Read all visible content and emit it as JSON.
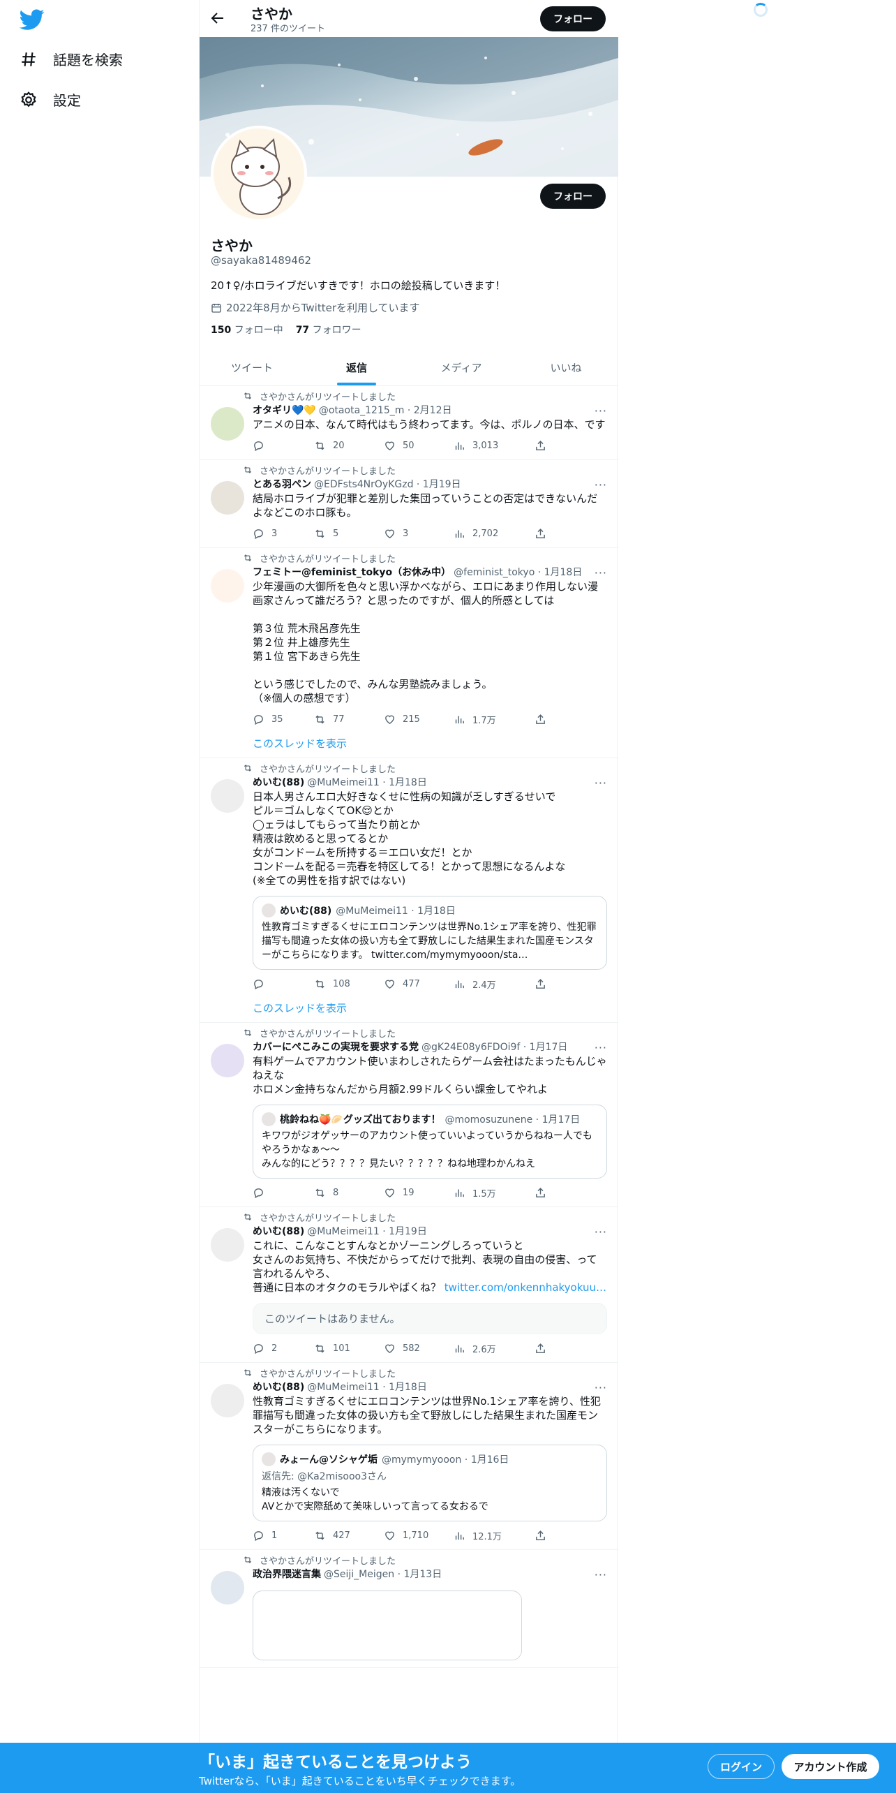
{
  "sidebar": {
    "items": [
      {
        "label": "話題を検索",
        "icon": "hashtag-icon"
      },
      {
        "label": "設定",
        "icon": "gear-icon"
      }
    ]
  },
  "header": {
    "name": "さやか",
    "tweet_count": "237 件のツイート",
    "follow_label": "フォロー"
  },
  "profile": {
    "name": "さやか",
    "handle": "@sayaka81489462",
    "bio": "20↑♀/ホロライブだいすきです！ホロの絵投稿していきます！",
    "joined": "2022年8月からTwitterを利用しています",
    "following_count": "150",
    "following_label": "フォロー中",
    "followers_count": "77",
    "followers_label": "フォロワー",
    "follow_label": "フォロー"
  },
  "tabs": [
    {
      "label": "ツイート",
      "active": false
    },
    {
      "label": "返信",
      "active": true
    },
    {
      "label": "メディア",
      "active": false
    },
    {
      "label": "いいね",
      "active": false
    }
  ],
  "retweet_label": "さやかさんがリツイートしました",
  "show_thread_label": "このスレッドを表示",
  "tweets": [
    {
      "name": "オタギリ💙💛",
      "meta": "@otaota_1215_m · 2月12日",
      "text": "アニメの日本、なんて時代はもう終わってます。今は、ポルノの日本、です",
      "reply": "",
      "retweets": "20",
      "likes": "50",
      "views": "3,013"
    },
    {
      "name": "とある羽ペン",
      "meta": "@EDFsts4NrOyKGzd · 1月19日",
      "text": "結局ホロライブが犯罪と差別した集団っていうことの否定はできないんだよなどこのホロ豚も。",
      "reply": "3",
      "retweets": "5",
      "likes": "3",
      "views": "2,702"
    },
    {
      "name": "フェミトー@feminist_tokyo（お休み中）",
      "meta": "@feminist_tokyo · 1月18日",
      "text": "少年漫画の大御所を色々と思い浮かべながら、エロにあまり作用しない漫画家さんって誰だろう？と思ったのですが、個人的所感としては\n\n第３位 荒木飛呂彦先生\n第２位 井上雄彦先生\n第１位 宮下あきら先生\n\nという感じでしたので、みんな男塾読みましょう。\n（※個人の感想です）",
      "reply": "35",
      "retweets": "77",
      "likes": "215",
      "views": "1.7万"
    },
    {
      "name": "めいむ(88)",
      "meta": "@MuMeimei11 · 1月18日",
      "text": "日本人男さんエロ大好きなくせに性病の知識が乏しすぎるせいで\nピル＝ゴムしなくてOK😌とか\n◯ェラはしてもらって当たり前とか\n精液は飲めると思ってるとか\n女がコンドームを所持する＝エロい女だ！とか\nコンドームを配る＝売春を特区してる！とかって思想になるんよな\n(※全ての男性を指す訳ではない)",
      "quote_name": "めいむ(88)",
      "quote_meta": "@MuMeimei11 · 1月18日",
      "quote_text": "性教育ゴミすぎるくせにエロコンテンツは世界No.1シェア率を誇り、性犯罪描写も間違った女体の扱い方も全て野放しにした結果生まれた国産モンスターがこちらになります。 twitter.com/mymymyooon/sta…",
      "reply": "",
      "retweets": "108",
      "likes": "477",
      "views": "2.4万"
    },
    {
      "name": "カバーにぺこみこの実現を要求する党",
      "meta": "@gK24E08y6FDOi9f · 1月17日",
      "text": "有料ゲームでアカウント使いまわしされたらゲーム会社はたまったもんじゃねえな\nホロメン金持ちなんだから月額2.99ドルくらい課金してやれよ",
      "quote_name": "桃鈴ねね🍑🥟グッズ出ております！",
      "quote_meta": "@momosuzunene · 1月17日",
      "quote_text": "キワワがジオゲッサーのアカウント使っていいよっていうからねねー人でもやろうかなぁ～～\nみんな的にどう？？？？見たい？？？？？ねね地理わかんねえ",
      "reply": "",
      "retweets": "8",
      "likes": "19",
      "views": "1.5万"
    },
    {
      "name": "めいむ(88)",
      "meta": "@MuMeimei11 · 1月19日",
      "text": "これに、こんなことすんなとかゾーニングしろっていうと\n女さんのお気持ち、不快だからってだけで批判、表現の自由の侵害、って言われるんやろ、\n普通に日本のオタクのモラルやばくね？ ",
      "link": "twitter.com/onkennhakyokuu…",
      "unavailable": "このツイートはありません。",
      "reply": "2",
      "retweets": "101",
      "likes": "582",
      "views": "2.6万"
    },
    {
      "name": "めいむ(88)",
      "meta": "@MuMeimei11 · 1月18日",
      "text": "性教育ゴミすぎるくせにエロコンテンツは世界No.1シェア率を誇り、性犯罪描写も間違った女体の扱い方も全て野放しにした結果生まれた国産モンスターがこちらになります。",
      "quote_name": "みょーん@ソシャゲ垢",
      "quote_meta": "@mymymyooon · 1月16日",
      "quote_reply_to": "返信先: @Ka2misooo3さん",
      "quote_text": "精液は汚くないで\nAVとかで実際舐めて美味しいって言ってる女おるで",
      "reply": "1",
      "retweets": "427",
      "likes": "1,710",
      "views": "12.1万"
    },
    {
      "name": "政治界隈迷言集",
      "meta": "@Seiji_Meigen · 1月13日"
    }
  ],
  "bottom_bar": {
    "title": "「いま」起きていることを見つけよう",
    "subtitle": "Twitterなら、「いま」起きていることをいち早くチェックできます。",
    "login": "ログイン",
    "signup": "アカウント作成"
  },
  "colors": {
    "accent": "#1d9bf0",
    "text": "#0f1419",
    "muted": "#536471",
    "border": "#eff3f4"
  }
}
